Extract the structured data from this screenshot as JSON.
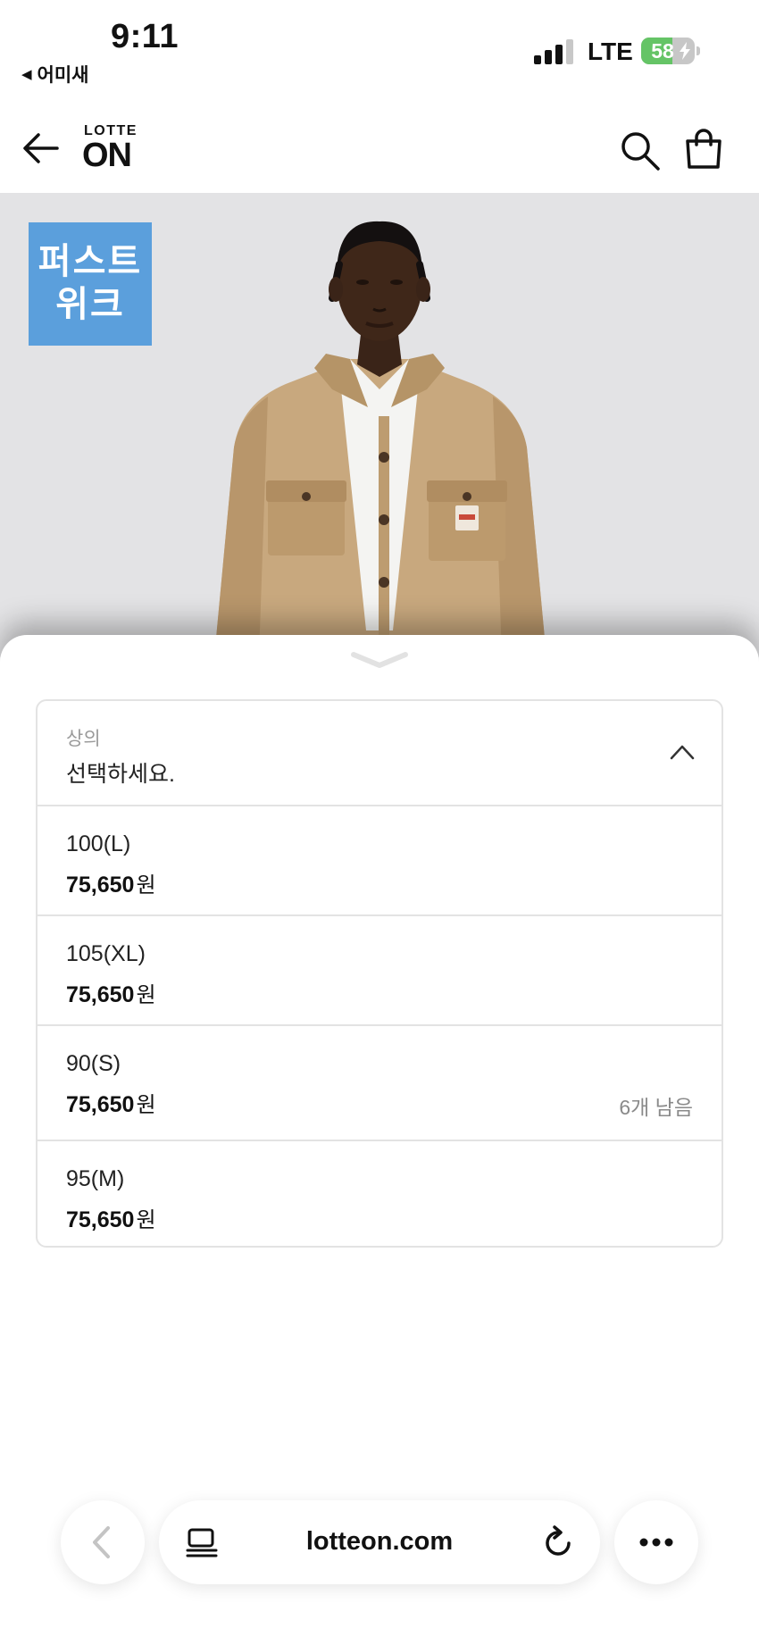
{
  "status_bar": {
    "time": "9:11",
    "back_app": "어미새",
    "network": "LTE",
    "battery_level": "58",
    "battery_fraction": 0.58
  },
  "header": {
    "logo_top": "LOTTE",
    "logo_main": "ON",
    "icons": [
      "back-arrow-icon",
      "search-icon",
      "shopping-bag-icon"
    ]
  },
  "hero": {
    "badge_line1": "퍼스트",
    "badge_line2": "위크",
    "badge_color": "#5b9fdc"
  },
  "option_sheet": {
    "category_label": "상의",
    "placeholder": "선택하세요.",
    "options": [
      {
        "name": "100(L)",
        "price": "75,650",
        "unit": "원",
        "stock": ""
      },
      {
        "name": "105(XL)",
        "price": "75,650",
        "unit": "원",
        "stock": ""
      },
      {
        "name": "90(S)",
        "price": "75,650",
        "unit": "원",
        "stock": "6개 남음"
      },
      {
        "name": "95(M)",
        "price": "75,650",
        "unit": "원",
        "stock": ""
      }
    ]
  },
  "browser": {
    "url": "lotteon.com",
    "icons": [
      "chevron-left-icon",
      "tabs-icon",
      "reload-icon",
      "more-icon"
    ]
  }
}
